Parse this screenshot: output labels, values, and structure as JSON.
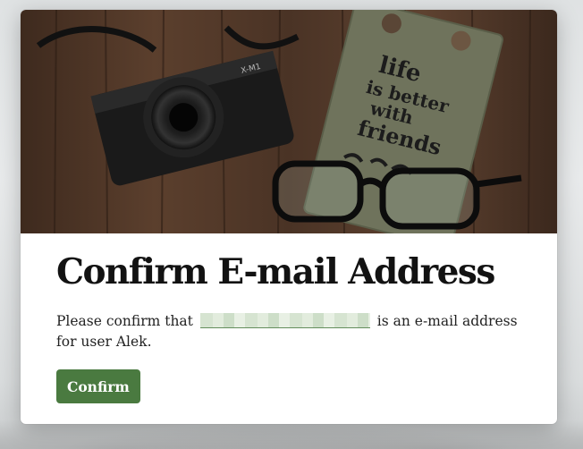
{
  "hero": {
    "image": "camera-notebook-glasses-photo",
    "notebook_text": [
      "life",
      "is better",
      "with",
      "friends"
    ]
  },
  "dialog": {
    "title": "Confirm E-mail Address",
    "message_before": "Please confirm that",
    "message_after": "is an e-mail address for user Alek.",
    "email_value": "",
    "confirm_label": "Confirm"
  },
  "colors": {
    "accent": "#4a7a40",
    "title": "#121212",
    "text": "#222222",
    "card": "#ffffff"
  }
}
